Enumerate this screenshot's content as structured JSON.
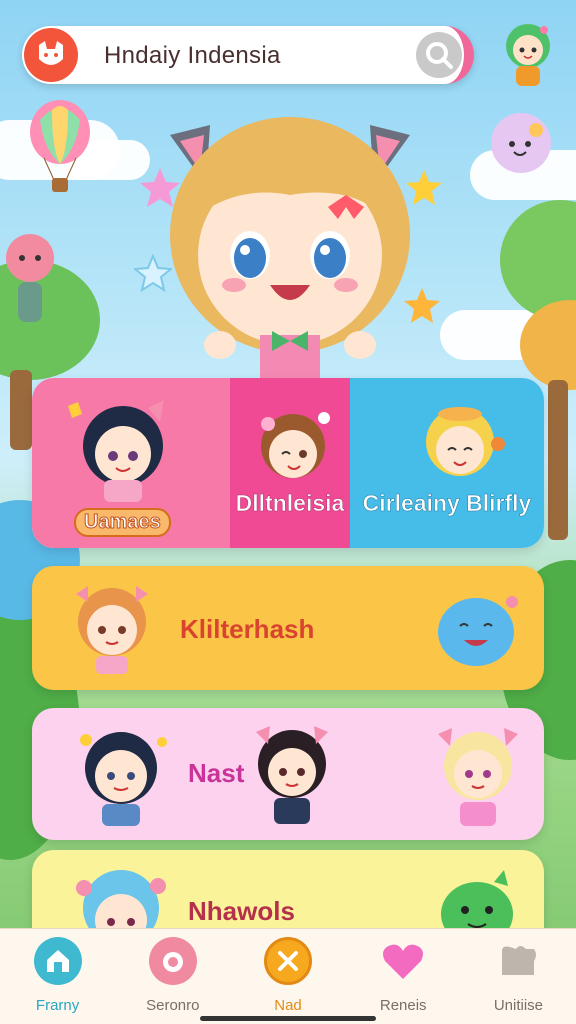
{
  "search": {
    "query": "Hndaiy Indensia"
  },
  "categories": {
    "games_label": "Uamaes",
    "b_label": "Dlltnleisia",
    "c_label": "Cirleainy Blirfly"
  },
  "rows": [
    {
      "label": "Klilterhash",
      "color": "#d9442f"
    },
    {
      "label": "Nast",
      "color": "#c8349a"
    },
    {
      "label": "Nhawols",
      "color": "#b5304a"
    }
  ],
  "nav": [
    {
      "label": "Frarny",
      "icon": "home-icon",
      "color": "#2ca6bf"
    },
    {
      "label": "Seronro",
      "icon": "camera-icon",
      "color": "#7a6f68"
    },
    {
      "label": "Nad",
      "icon": "close-icon",
      "color": "#e38a15"
    },
    {
      "label": "Reneis",
      "icon": "heart-icon",
      "color": "#7a6f68"
    },
    {
      "label": "Unitiise",
      "icon": "puzzle-icon",
      "color": "#7a6f68"
    }
  ],
  "colors": {
    "accent_pink": "#f0679a",
    "accent_orange": "#f2553a",
    "panel_yellow": "#fbc648",
    "panel_blue": "#45bde8"
  }
}
